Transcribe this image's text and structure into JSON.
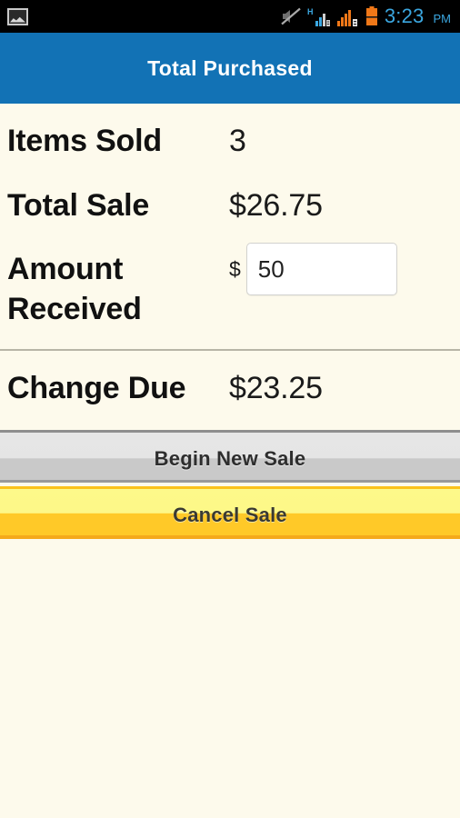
{
  "status_bar": {
    "left_icons": [
      {
        "name": "gallery-icon",
        "label": "Gallery notification"
      }
    ],
    "right_icons": [
      {
        "name": "mute-icon",
        "label": "Sound muted"
      },
      {
        "name": "signal-hspa-icon",
        "label": "H signal SIM 1"
      },
      {
        "name": "signal-icon",
        "label": "Signal SIM 2"
      },
      {
        "name": "battery-icon",
        "label": "Battery"
      }
    ],
    "time": "3:23",
    "ampm": "PM",
    "time_color": "#3ba7e0",
    "background": "#000000"
  },
  "header": {
    "title": "Total Purchased",
    "background": "#1272b5",
    "text_color": "#ffffff"
  },
  "page": {
    "background": "#fdfaec"
  },
  "summary": {
    "items_sold": {
      "label": "Items Sold",
      "value": "3"
    },
    "total_sale": {
      "label": "Total Sale",
      "value": "$26.75"
    },
    "amount_received": {
      "label": "Amount Received",
      "currency_symbol": "$",
      "input_value": "50",
      "input_placeholder": ""
    },
    "change_due": {
      "label": "Change Due",
      "value": "$23.25"
    }
  },
  "actions": {
    "begin_new_sale": "Begin New Sale",
    "cancel_sale": "Cancel Sale",
    "begin_new_sale_color": "#d8d8d8",
    "cancel_sale_color": "#ffc928"
  }
}
